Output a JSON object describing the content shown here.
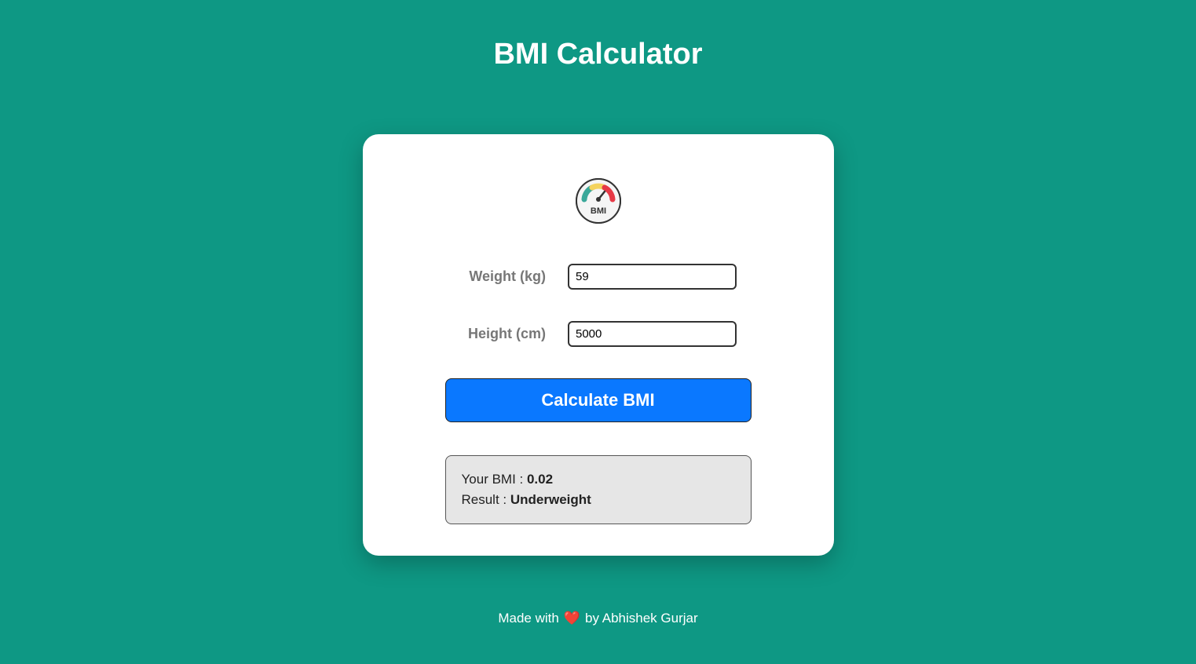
{
  "title": "BMI Calculator",
  "logo": {
    "text": "BMI"
  },
  "inputs": {
    "weight": {
      "label": "Weight (kg)",
      "value": "59"
    },
    "height": {
      "label": "Height (cm)",
      "value": "5000"
    }
  },
  "button": {
    "label": "Calculate BMI"
  },
  "result": {
    "bmi_label": "Your BMI : ",
    "bmi_value": "0.02",
    "result_label": "Result : ",
    "result_value": "Underweight"
  },
  "footer": {
    "prefix": "Made with ",
    "suffix": " by Abhishek Gurjar"
  }
}
